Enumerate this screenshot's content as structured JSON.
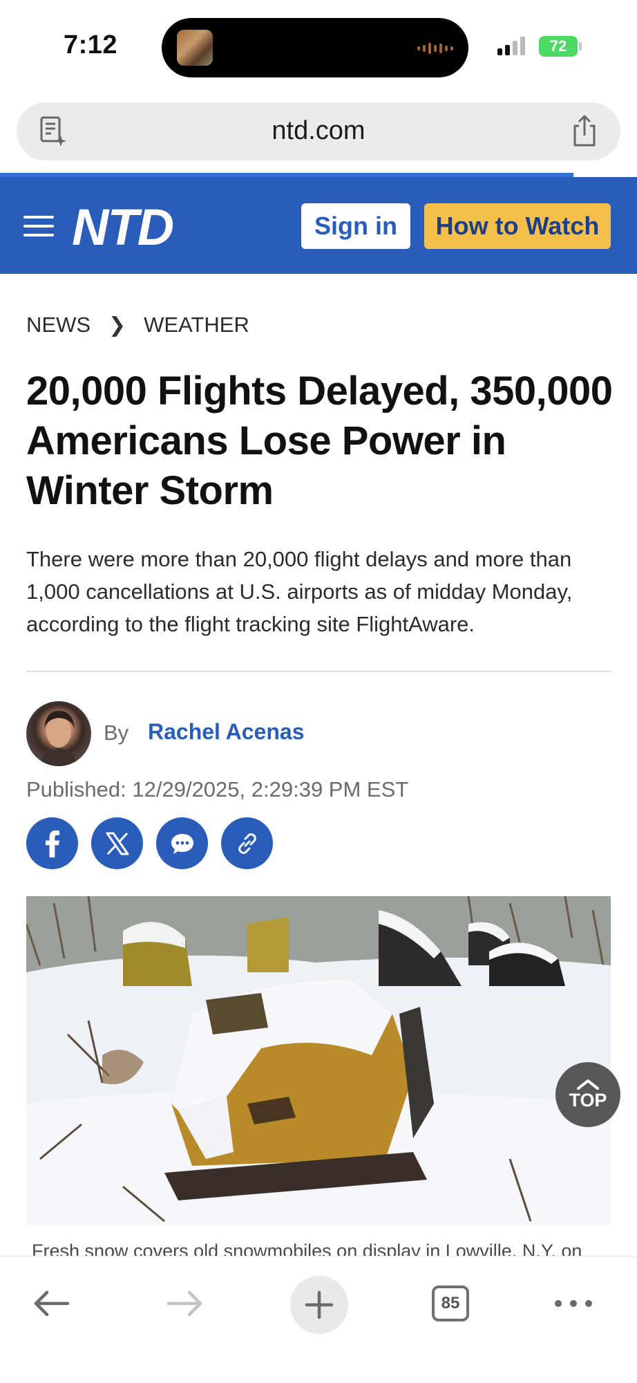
{
  "status_bar": {
    "time": "7:12",
    "battery": "72",
    "battery_color": "#4cd964"
  },
  "browser": {
    "url": "ntd.com",
    "reader_icon": "reader-mode-icon",
    "share_icon": "share-icon",
    "load_progress": 0.9
  },
  "site_header": {
    "logo": "NTD",
    "sign_in_label": "Sign in",
    "how_to_watch_label": "How to Watch",
    "brand_color": "#2a5db9",
    "accent_color": "#f5c04a"
  },
  "breadcrumb": {
    "items": [
      "NEWS",
      "WEATHER"
    ]
  },
  "article": {
    "headline": "20,000 Flights Delayed, 350,000 Americans Lose Power in Winter Storm",
    "summary": "There were more than 20,000 flight delays and more than 1,000 cancellations at U.S. airports as of midday Monday, according to the flight tracking site FlightAware.",
    "by_label": "By",
    "author": "Rachel Acenas",
    "published": "Published: 12/29/2025, 2:29:39 PM EST",
    "social_icons": [
      "facebook-icon",
      "x-icon",
      "message-icon",
      "link-icon"
    ],
    "photo_caption": "Fresh snow covers old snowmobiles on display in Lowville, N.Y. on",
    "top_button_label": "TOP"
  },
  "toolbar": {
    "tab_count": "85",
    "icons": [
      "back-arrow-icon",
      "forward-arrow-icon",
      "plus-icon",
      "tabs-icon",
      "more-icon"
    ]
  }
}
